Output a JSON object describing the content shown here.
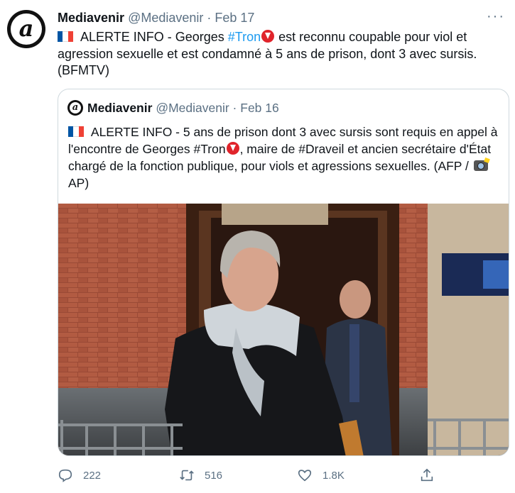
{
  "tweet": {
    "display_name": "Mediavenir",
    "handle": "@Mediavenir",
    "separator": "·",
    "date": "Feb 17",
    "more_label": "···",
    "text_part1": " ALERTE INFO - Georges ",
    "hashtag": "#Tron",
    "text_part2": " est reconnu coupable pour viol et agression sexuelle et est condamné à 5 ans de prison, dont 3 avec sursis. (BFMTV)"
  },
  "quoted": {
    "display_name": "Mediavenir",
    "handle": "@Mediavenir",
    "separator": "·",
    "date": "Feb 16",
    "text_part1": " ALERTE INFO - 5 ans de prison dont 3 avec sursis sont requis en appel à l'encontre de Georges #Tron",
    "text_part2": ", maire de #Draveil et ancien secrétaire d'État chargé de la fonction publique, pour viols et agressions sexuelles. (AFP / ",
    "text_part3": " AP)"
  },
  "actions": {
    "reply_count": "222",
    "retweet_count": "516",
    "like_count": "1.8K"
  },
  "icons": {
    "avatar": "mediavenir-logo-icon",
    "reply": "reply-icon",
    "retweet": "retweet-icon",
    "like": "heart-icon",
    "share": "share-icon"
  },
  "colors": {
    "link": "#1d9bf0",
    "muted": "#5b7083",
    "border": "#cfd9de"
  }
}
